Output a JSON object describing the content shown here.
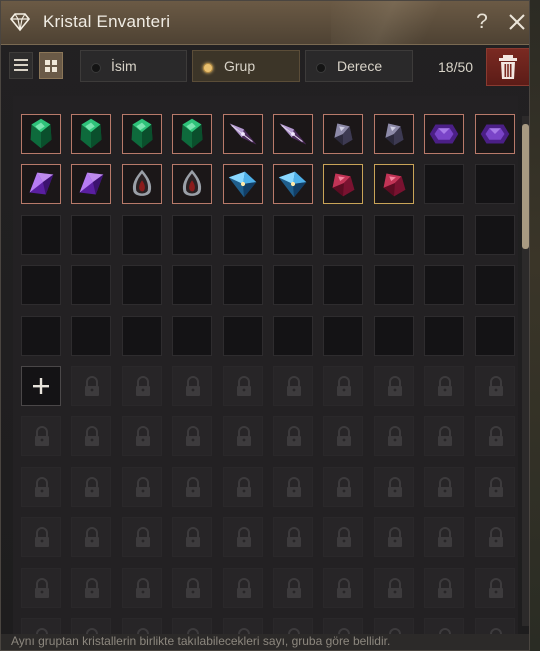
{
  "window": {
    "title": "Kristal Envanteri",
    "title_icon": "diamond-icon",
    "help_label": "?",
    "close_icon": "close-icon"
  },
  "toolbar": {
    "view_list_icon": "list-view-icon",
    "view_grid_icon": "grid-view-icon",
    "sort_options": [
      {
        "label": "İsim",
        "selected": false
      },
      {
        "label": "Grup",
        "selected": true
      },
      {
        "label": "Derece",
        "selected": false
      }
    ],
    "count_text": "18/50",
    "trash_icon": "trash-icon"
  },
  "grid": {
    "columns": 10,
    "items": [
      {
        "kind": "green-emerald-crystal"
      },
      {
        "kind": "green-emerald-crystal"
      },
      {
        "kind": "green-emerald-crystal"
      },
      {
        "kind": "green-emerald-crystal"
      },
      {
        "kind": "dark-violet-spiked-crystal"
      },
      {
        "kind": "dark-violet-spiked-crystal"
      },
      {
        "kind": "grey-violet-shard-crystal"
      },
      {
        "kind": "grey-violet-shard-crystal"
      },
      {
        "kind": "purple-hexagon-crystal"
      },
      {
        "kind": "purple-hexagon-crystal"
      },
      {
        "kind": "purple-prism-crystal"
      },
      {
        "kind": "purple-prism-crystal"
      },
      {
        "kind": "silver-red-drop-crystal"
      },
      {
        "kind": "silver-red-drop-crystal"
      },
      {
        "kind": "blue-spiked-crystal"
      },
      {
        "kind": "blue-spiked-crystal"
      },
      {
        "kind": "red-ruby-crystal"
      },
      {
        "kind": "red-ruby-crystal"
      }
    ],
    "gold_frame_items": [
      16,
      17
    ],
    "empty_slots": 32,
    "add_slot_icon": "plus-icon",
    "lock_icon": "lock-icon"
  },
  "footer": {
    "text": "Aynı gruptan kristallerin birlikte takılabilecekleri sayı, gruba göre bellidir."
  },
  "colors": {
    "title_bar": "#5c4c3a",
    "accent_gold": "#c9a458",
    "item_frame": "#b87a6a",
    "trash": "#6e241d"
  }
}
